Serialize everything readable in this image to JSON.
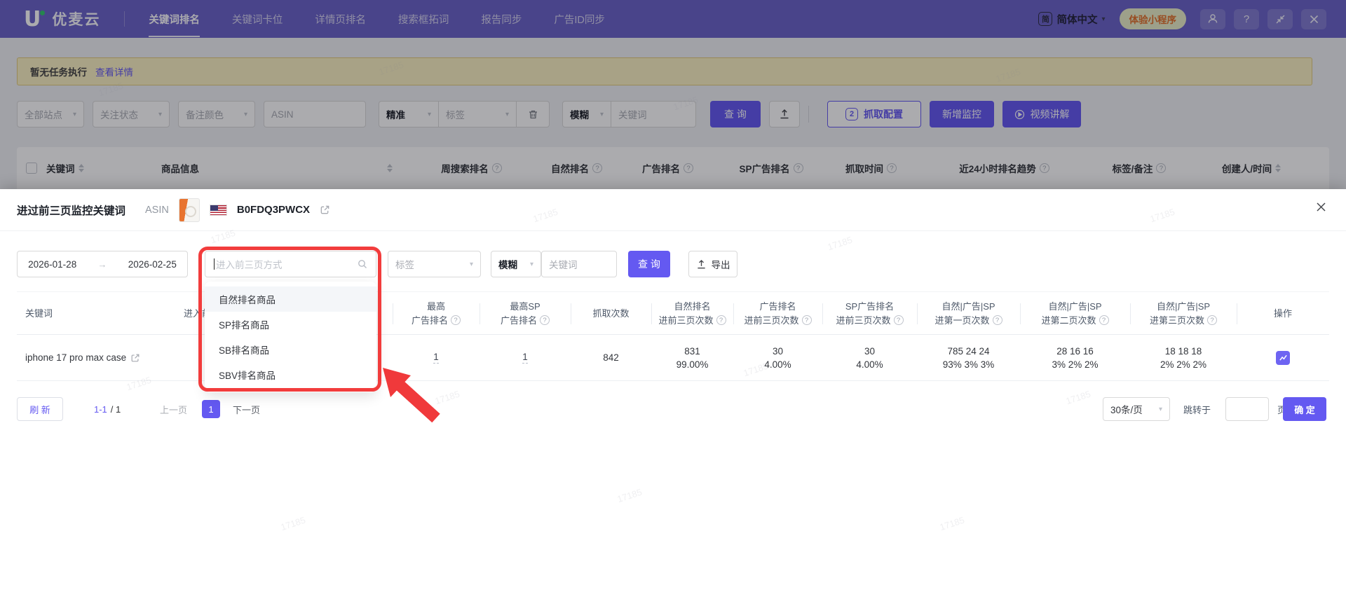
{
  "watermark": "17185",
  "colors": {
    "accent": "#6459F1",
    "nav": "#6B63C8",
    "highlight_red": "#F23C3C",
    "warning_bg": "#FBF1C2"
  },
  "nav": {
    "brand": "优麦云",
    "items": [
      {
        "label": "关键词排名"
      },
      {
        "label": "关键词卡位"
      },
      {
        "label": "详情页排名"
      },
      {
        "label": "搜索框拓词"
      },
      {
        "label": "报告同步"
      },
      {
        "label": "广告ID同步"
      }
    ],
    "lang_badge": "简",
    "language": "简体中文",
    "mini_program": "体验小程序",
    "help": "?"
  },
  "backdrop": {
    "notice": {
      "text": "暂无任务执行",
      "link": "查看详情"
    },
    "filters": {
      "site": "全部站点",
      "follow": "关注状态",
      "note_color": "备注颜色",
      "asin_placeholder": "ASIN",
      "match": "精准",
      "tag": "标签",
      "fuzzy": "模糊",
      "keyword_placeholder": "关键词",
      "search": "查 询",
      "config": "抓取配置",
      "config_badge": "2",
      "add": "新增监控",
      "video": "视频讲解"
    },
    "table_headers": [
      {
        "label": "关键词"
      },
      {
        "label": "商品信息"
      },
      {
        "label": "周搜索排名"
      },
      {
        "label": "自然排名"
      },
      {
        "label": "广告排名"
      },
      {
        "label": "SP广告排名"
      },
      {
        "label": "抓取时间"
      },
      {
        "label": "近24小时排名趋势"
      },
      {
        "label": "标签/备注"
      },
      {
        "label": "创建人/时间"
      }
    ]
  },
  "modal": {
    "title": "进过前三页监控关键词",
    "asin_label": "ASIN",
    "asin": "B0FDQ3PWCX",
    "date_from": "2026-01-28",
    "date_to": "2026-02-25",
    "filter": {
      "entry_placeholder": "进入前三页方式",
      "tag": "标签",
      "fuzzy": "模糊",
      "keyword_placeholder": "关键词",
      "search": "查 询",
      "export": "导出"
    },
    "dropdown": {
      "options": [
        {
          "label": "自然排名商品"
        },
        {
          "label": "SP排名商品"
        },
        {
          "label": "SB排名商品"
        },
        {
          "label": "SBV排名商品"
        }
      ]
    },
    "table": {
      "headers": [
        {
          "t": "关键词"
        },
        {
          "t": "进入前三页方式"
        },
        {
          "l1": "最高",
          "l2": "广告排名"
        },
        {
          "l1": "最高SP",
          "l2": "广告排名"
        },
        {
          "t": "抓取次数"
        },
        {
          "l1": "自然排名",
          "l2": "进前三页次数"
        },
        {
          "l1": "广告排名",
          "l2": "进前三页次数"
        },
        {
          "l1": "SP广告排名",
          "l2": "进前三页次数"
        },
        {
          "l1": "自然|广告|SP",
          "l2": "进第一页次数"
        },
        {
          "l1": "自然|广告|SP",
          "l2": "进第二页次数"
        },
        {
          "l1": "自然|广告|SP",
          "l2": "进第三页次数"
        },
        {
          "t": "操作"
        }
      ],
      "row": {
        "keyword": "iphone 17 pro max case",
        "max_ad_rank": "1",
        "max_sp_ad_rank": "1",
        "crawl_count": "842",
        "organic_top3": {
          "n": "831",
          "p": "99.00%"
        },
        "ad_top3": {
          "n": "30",
          "p": "4.00%"
        },
        "sp_ad_top3": {
          "n": "30",
          "p": "4.00%"
        },
        "page1": {
          "n": "785 24 24",
          "p": "93% 3% 3%"
        },
        "page2": {
          "n": "28 16 16",
          "p": "3% 2% 2%"
        },
        "page3": {
          "n": "18 18 18",
          "p": "2% 2% 2%"
        }
      }
    },
    "pagination": {
      "refresh": "刷 新",
      "range": "1-1",
      "total": "/ 1",
      "prev": "上一页",
      "current": "1",
      "next": "下一页",
      "page_size": "30条/页",
      "jump_label": "跳转于",
      "jump_unit": "页",
      "confirm": "确 定"
    }
  }
}
